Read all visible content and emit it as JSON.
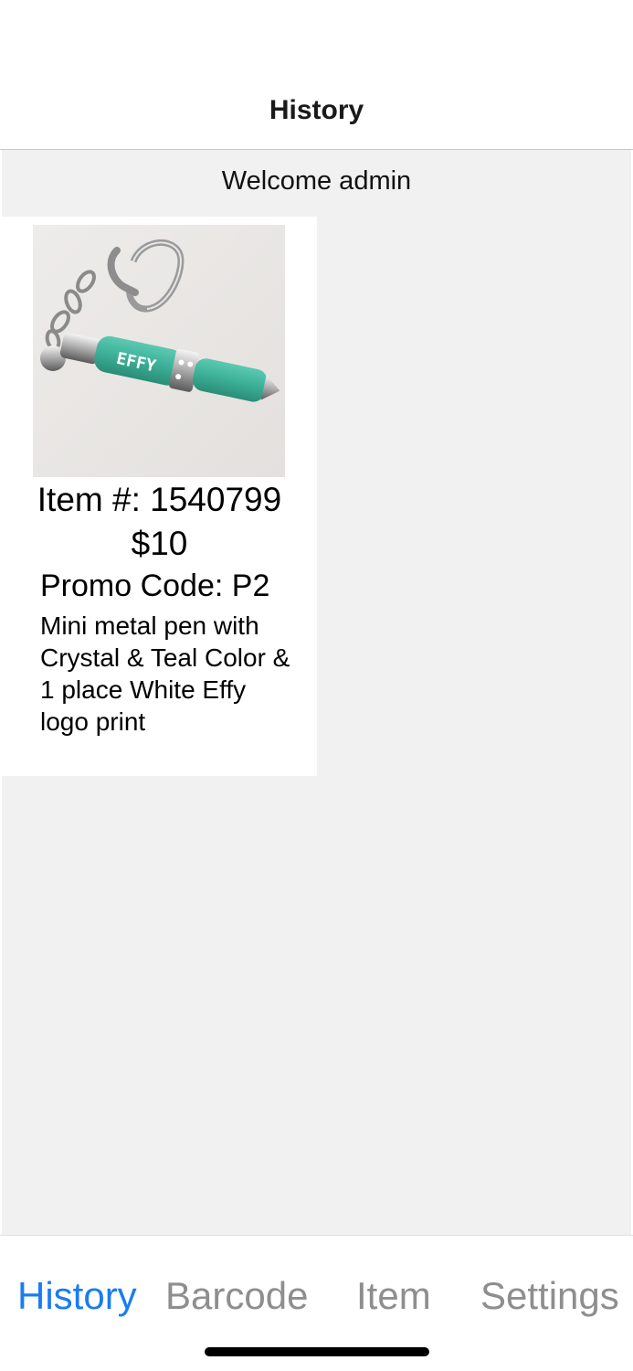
{
  "navbar": {
    "title": "History"
  },
  "main": {
    "welcome_text": "Welcome admin",
    "items": [
      {
        "item_number": "Item #: 1540799",
        "price": "$10",
        "promo_code": "Promo Code: P2",
        "description": "Mini metal pen with Crystal & Teal Color & 1 place White Effy logo print",
        "image_logo_text": "EFFY"
      }
    ]
  },
  "tabbar": {
    "tabs": [
      {
        "label": "History",
        "active": true
      },
      {
        "label": "Barcode",
        "active": false
      },
      {
        "label": "Item",
        "active": false
      },
      {
        "label": "Settings",
        "active": false
      }
    ]
  },
  "colors": {
    "accent": "#1a7cf2",
    "inactive_tab": "#8e8e8e",
    "content_background": "#f1f1f1",
    "pen_teal": "#3fb39a"
  }
}
